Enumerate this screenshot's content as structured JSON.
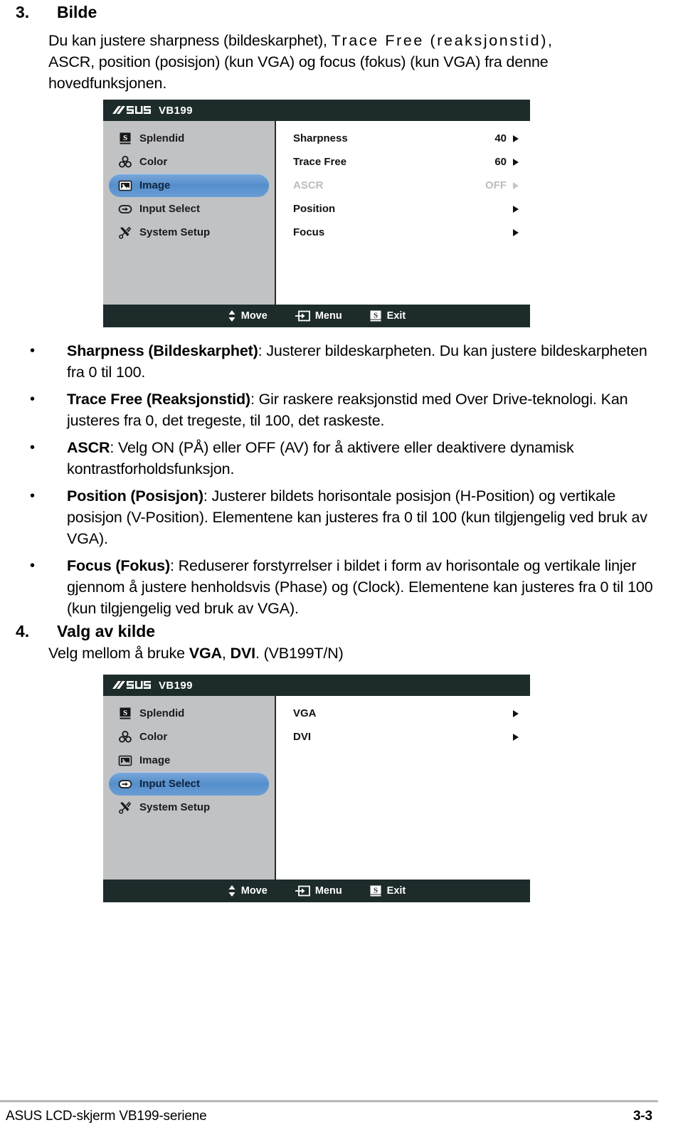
{
  "sections": {
    "s3": {
      "number": "3.",
      "title": "Bilde",
      "paragraph_line1_a": "Du kan justere sharpness (bildeskarphet), ",
      "paragraph_line1_b": "Trace Free (reaksjonstid)",
      "paragraph_line1_c": ",",
      "paragraph_line2": "ASCR, position (posisjon) (kun VGA) og focus (fokus) (kun VGA) fra denne",
      "paragraph_line3": "hovedfunksjonen."
    },
    "s4": {
      "number": "4.",
      "title": "Valg av kilde",
      "line_a": "Velg mellom å bruke ",
      "line_b": "VGA",
      "line_c": ", ",
      "line_d": "DVI",
      "line_e": ". (VB199T/N)"
    }
  },
  "bullets": [
    {
      "marker": "•",
      "bold": "Sharpness (Bildeskarphet)",
      "rest": ": Justerer bildeskarpheten. Du kan justere bildeskarpheten fra 0 til 100."
    },
    {
      "marker": "•",
      "bold": "Trace Free (Reaksjonstid)",
      "rest": ": Gir raskere reaksjonstid med Over Drive-teknologi. Kan justeres fra 0, det tregeste, til 100, det raskeste."
    },
    {
      "marker": "•",
      "bold": "ASCR",
      "rest": ": Velg ON (PÅ) eller OFF (AV) for å aktivere eller deaktivere dynamisk kontrastforholdsfunksjon."
    },
    {
      "marker": "•",
      "bold": "Position (Posisjon)",
      "rest": ": Justerer bildets horisontale posisjon (H-Position) og vertikale posisjon (V-Position). Elementene kan justeres fra 0 til 100 (kun tilgjengelig ved bruk av VGA)."
    },
    {
      "marker": "•",
      "bold": "Focus (Fokus)",
      "rest": ": Reduserer forstyrrelser i bildet i form av horisontale og vertikale linjer gjennom å justere henholdsvis (Phase) og (Clock). Elementene kan justeres fra 0 til 100 (kun tilgjengelig ved bruk av VGA)."
    }
  ],
  "osd_image": {
    "brand": "ASUS",
    "model": "VB199",
    "sidebar": [
      {
        "label": "Splendid",
        "icon": "splendid-icon",
        "selected": false
      },
      {
        "label": "Color",
        "icon": "color-icon",
        "selected": false
      },
      {
        "label": "Image",
        "icon": "image-icon",
        "selected": true
      },
      {
        "label": "Input Select",
        "icon": "input-select-icon",
        "selected": false
      },
      {
        "label": "System Setup",
        "icon": "system-setup-icon",
        "selected": false
      }
    ],
    "rows": [
      {
        "label": "Sharpness",
        "value": "40",
        "dim": false
      },
      {
        "label": "Trace Free",
        "value": "60",
        "dim": false
      },
      {
        "label": "ASCR",
        "value": "OFF",
        "dim": true
      },
      {
        "label": "Position",
        "value": "",
        "dim": false
      },
      {
        "label": "Focus",
        "value": "",
        "dim": false
      }
    ],
    "footer": {
      "move": "Move",
      "menu": "Menu",
      "exit": "Exit"
    }
  },
  "osd_input": {
    "brand": "ASUS",
    "model": "VB199",
    "sidebar": [
      {
        "label": "Splendid",
        "icon": "splendid-icon",
        "selected": false
      },
      {
        "label": "Color",
        "icon": "color-icon",
        "selected": false
      },
      {
        "label": "Image",
        "icon": "image-icon",
        "selected": false
      },
      {
        "label": "Input Select",
        "icon": "input-select-icon",
        "selected": true
      },
      {
        "label": "System Setup",
        "icon": "system-setup-icon",
        "selected": false
      }
    ],
    "rows": [
      {
        "label": "VGA",
        "value": "",
        "dim": false
      },
      {
        "label": "DVI",
        "value": "",
        "dim": false
      }
    ],
    "footer": {
      "move": "Move",
      "menu": "Menu",
      "exit": "Exit"
    }
  },
  "page_footer": {
    "left": "ASUS LCD-skjerm VB199-seriene",
    "right": "3-3"
  },
  "colors": {
    "osd_titlebar": "#1d2b2b",
    "osd_sidebar": "#c0c2c4",
    "osd_selected": "#548fcc",
    "osd_dim_text": "#bcbcbc",
    "footer_rule": "#b8b8b8"
  }
}
